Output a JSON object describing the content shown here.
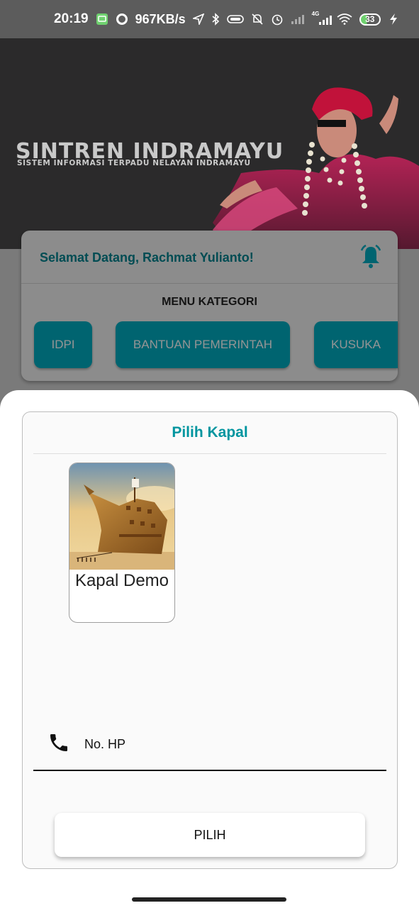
{
  "status_bar": {
    "time": "20:19",
    "network_speed": "967KB/s",
    "network_type": "4G",
    "battery": "33",
    "icons": [
      "screenshot-icon",
      "whatsapp-icon",
      "location-icon",
      "bluetooth-icon",
      "vpn-icon",
      "mute-icon",
      "alarm-icon",
      "signal-icon",
      "wifi-icon",
      "battery-icon",
      "charging-icon"
    ]
  },
  "banner": {
    "title": "SINTREN INDRAMAYU",
    "subtitle": "SISTEM INFORMASI TERPADU NELAYAN INDRAMAYU"
  },
  "home": {
    "welcome": "Selamat Datang, Rachmat Yulianto!",
    "menu_title": "MENU KATEGORI",
    "menu_items": [
      {
        "label": "IDPI"
      },
      {
        "label": "BANTUAN PEMERINTAH"
      },
      {
        "label": "KUSUKA"
      }
    ]
  },
  "sheet": {
    "title": "Pilih Kapal",
    "ships": [
      {
        "name": "Kapal Demo"
      }
    ],
    "phone_field_label": "No. HP",
    "submit_label": "PILIH"
  },
  "colors": {
    "primary": "#00acc1",
    "title_teal": "#00959f",
    "welcome_teal": "#00838f"
  }
}
